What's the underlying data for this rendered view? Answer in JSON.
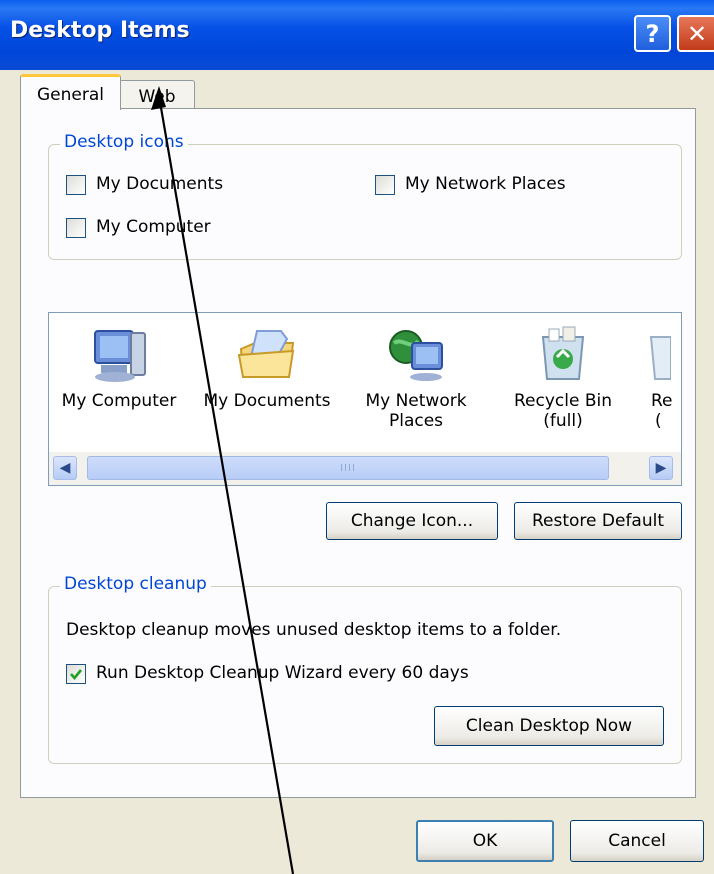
{
  "window": {
    "title": "Desktop Items",
    "help_glyph": "?",
    "close_glyph": "✕"
  },
  "tabs": [
    {
      "label": "General",
      "selected": true
    },
    {
      "label": "Web",
      "selected": false
    }
  ],
  "desktop_icons_group": {
    "legend": "Desktop icons",
    "checkboxes": [
      {
        "label": "My Documents",
        "checked": false
      },
      {
        "label": "My Network Places",
        "checked": false
      },
      {
        "label": "My Computer",
        "checked": false
      }
    ]
  },
  "icon_list": {
    "items": [
      {
        "label_line1": "My Computer",
        "label_line2": "",
        "icon": "my-computer-icon"
      },
      {
        "label_line1": "My Documents",
        "label_line2": "",
        "icon": "my-documents-icon"
      },
      {
        "label_line1": "My Network",
        "label_line2": "Places",
        "icon": "my-network-places-icon"
      },
      {
        "label_line1": "Recycle Bin",
        "label_line2": "(full)",
        "icon": "recycle-bin-full-icon"
      },
      {
        "label_line1": "Re",
        "label_line2": "(",
        "icon": "recycle-bin-empty-icon"
      }
    ],
    "scroll_left": "◀",
    "scroll_right": "▶",
    "thumb_grip": "IIII"
  },
  "icon_buttons": {
    "change_icon": "Change Icon...",
    "restore_default": "Restore Default"
  },
  "cleanup_group": {
    "legend": "Desktop cleanup",
    "description": "Desktop cleanup moves unused desktop items to a folder.",
    "wizard_checkbox": {
      "label": "Run Desktop Cleanup Wizard every 60 days",
      "checked": true
    },
    "clean_now": "Clean Desktop Now"
  },
  "footer": {
    "ok": "OK",
    "cancel": "Cancel"
  },
  "colors": {
    "titlebar": "#0550e6",
    "dialog_bg": "#ece9d8",
    "group_legend": "#0046d5",
    "tab_highlight": "#ffc83c"
  }
}
